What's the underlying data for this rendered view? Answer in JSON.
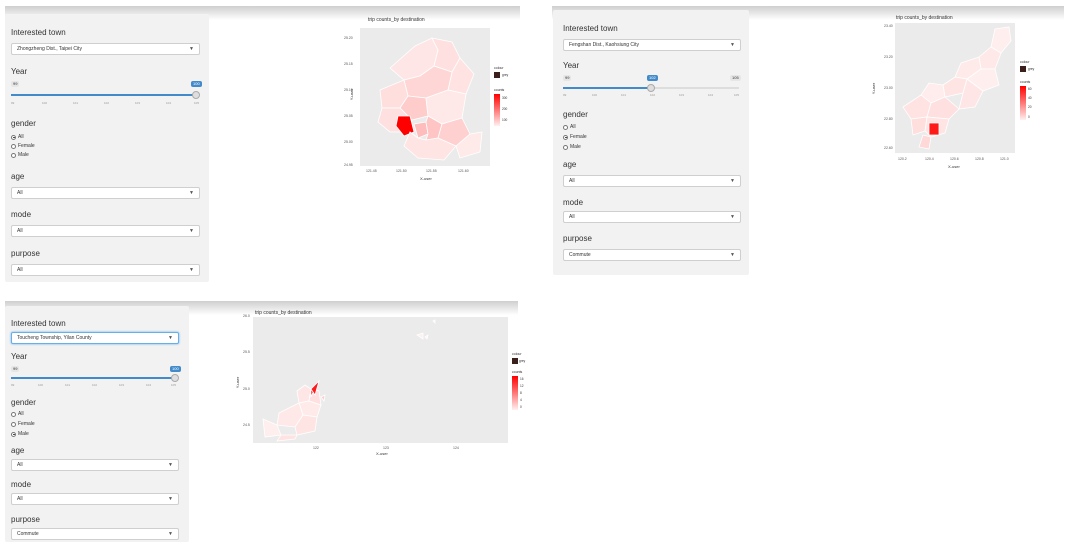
{
  "labels": {
    "interested_town": "Interested town",
    "year": "Year",
    "gender": "gender",
    "age": "age",
    "mode": "mode",
    "purpose": "purpose"
  },
  "gender_options": [
    "All",
    "Female",
    "Male"
  ],
  "colors": {
    "accent": "#428bca",
    "high": "#ff0000",
    "low": "#fff0f0",
    "sidebar": "#f2f2f2"
  },
  "panel1": {
    "town": "Zhongzheng Dist., Taipei City",
    "year": {
      "min": "99",
      "max": "100",
      "value": "100",
      "fill": 1.0,
      "ticks": [
        "99",
        "100",
        "101",
        "102",
        "103",
        "104",
        "105"
      ]
    },
    "gender_selected": "All",
    "age": "All",
    "mode": "All",
    "purpose": "All",
    "plot": {
      "title": "trip counts_by destination",
      "xlabel": "X-user",
      "ylabel": "Y-user",
      "yticks": [
        "25.20",
        "25.15",
        "25.10",
        "25.05",
        "25.00",
        "24.95"
      ],
      "xticks": [
        "121.45",
        "121.50",
        "121.55",
        "121.60"
      ],
      "legend_colour_title": "colour",
      "legend_colour_item": "grey",
      "legend_counts_title": "counts",
      "legend_counts_ticks": [
        "300",
        "200",
        "100"
      ]
    }
  },
  "panel2": {
    "town": "Fengshan Dist., Kaohsiung City",
    "year": {
      "min": "99",
      "max": "105",
      "value": "102",
      "fill": 0.5,
      "ticks": [
        "99",
        "100",
        "101",
        "102",
        "103",
        "104",
        "105"
      ]
    },
    "gender_selected": "Female",
    "age": "All",
    "mode": "All",
    "purpose": "Commute",
    "plot": {
      "title": "trip counts_by destination",
      "xlabel": "X-user",
      "ylabel": "Y-user",
      "yticks": [
        "23.40",
        "23.20",
        "23.00",
        "22.80",
        "22.60"
      ],
      "xticks": [
        "120.2",
        "120.4",
        "120.6",
        "120.8",
        "121.0"
      ],
      "legend_colour_title": "colour",
      "legend_colour_item": "grey",
      "legend_counts_title": "counts",
      "legend_counts_ticks": [
        "60",
        "40",
        "20",
        "0"
      ]
    }
  },
  "panel3": {
    "town": "Toucheng Township, Yilan County",
    "year": {
      "min": "99",
      "max": "100",
      "value": "100",
      "fill": 1.0,
      "ticks": [
        "99",
        "100",
        "101",
        "102",
        "103",
        "104",
        "105"
      ]
    },
    "gender_selected": "Male",
    "age": "All",
    "mode": "All",
    "purpose": "Commute",
    "plot": {
      "title": "trip counts_by destination",
      "xlabel": "X-user",
      "ylabel": "Y-user",
      "yticks": [
        "26.0",
        "25.5",
        "25.0",
        "24.5"
      ],
      "xticks": [
        "122",
        "123",
        "124"
      ],
      "legend_colour_title": "colour",
      "legend_colour_item": "grey",
      "legend_counts_title": "counts",
      "legend_counts_ticks": [
        "16",
        "12",
        "8",
        "4",
        "0"
      ]
    }
  }
}
